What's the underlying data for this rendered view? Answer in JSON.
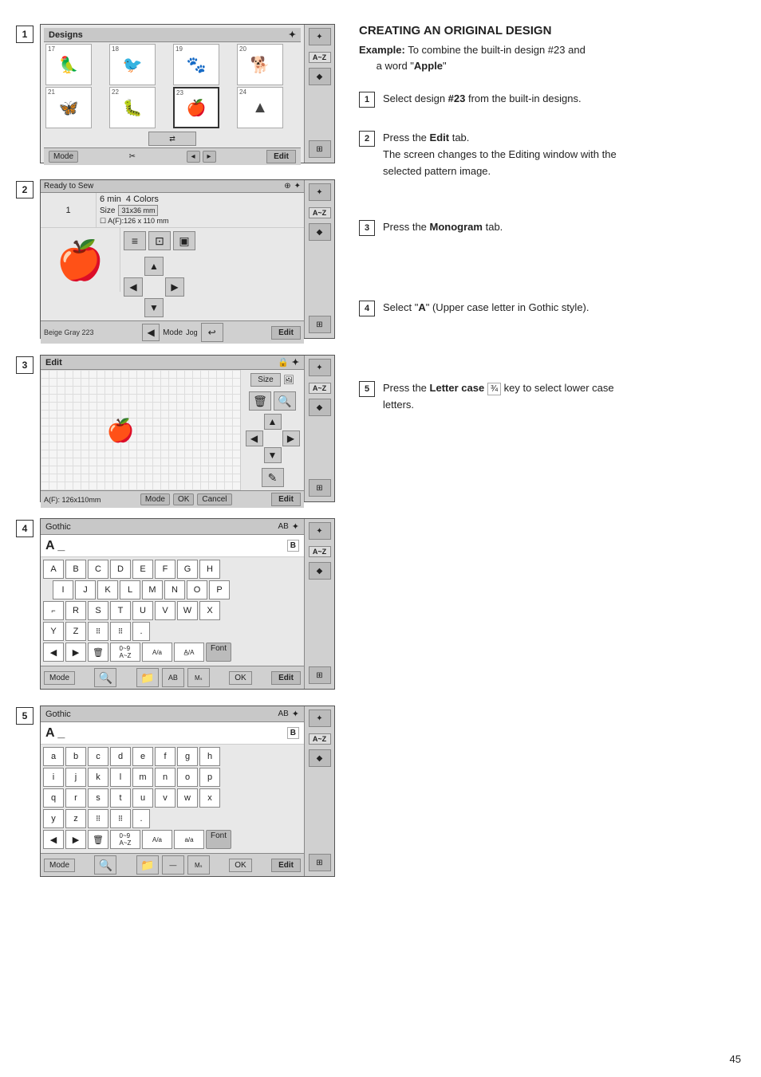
{
  "page": {
    "number": "45"
  },
  "right": {
    "title": "CREATING AN ORIGINAL DESIGN",
    "example_label": "Example:",
    "example_text": "To combine the built-in design #23 and a word \"Apple\"",
    "steps": [
      {
        "num": "1",
        "text": "Select design ",
        "bold": "#23",
        "text2": " from the built-in designs."
      },
      {
        "num": "2",
        "text": "Press the ",
        "bold": "Edit",
        "text2": " tab.\nThe screen changes to the Editing window with the selected pattern image."
      },
      {
        "num": "3",
        "text": "Press the ",
        "bold": "Monogram",
        "text2": " tab."
      },
      {
        "num": "4",
        "text": "Select \"",
        "bold": "A",
        "text2": "\" (Upper case letter in Gothic style)."
      },
      {
        "num": "5",
        "text": "Press the ",
        "bold": "Letter case",
        "text2": " key to select lower case letters."
      }
    ]
  },
  "screens": {
    "s1": {
      "title": "Designs",
      "nums": [
        "17",
        "18",
        "19",
        "20",
        "21",
        "22",
        "23",
        "24"
      ],
      "mode_label": "Mode",
      "edit_label": "Edit",
      "az_label": "A~Z"
    },
    "s2": {
      "title": "Ready to Sew",
      "time": "6 min",
      "colors": "4 Colors",
      "size_label": "Size",
      "size_val": "31x36 mm",
      "af_label": "A(F):126 x 110 mm",
      "thread_label": "Beige Gray 223",
      "mode_label": "Mode",
      "edit_label": "Edit",
      "az_label": "A~Z",
      "jog_label": "Jog"
    },
    "s3": {
      "title": "Edit",
      "size_label": "Size",
      "mode_label": "Mode",
      "ok_label": "OK",
      "cancel_label": "Cancel",
      "edit_label": "Edit",
      "af_label": "A(F): 126x110mm",
      "az_label": "A~Z"
    },
    "s4": {
      "font": "Gothic",
      "display": "A _",
      "uppercase_keys": [
        "A",
        "B",
        "C",
        "D",
        "E",
        "F",
        "G",
        "H",
        "I",
        "J",
        "K",
        "L",
        "M",
        "N",
        "O",
        "P",
        "Q",
        "R",
        "S",
        "T",
        "U",
        "V",
        "W",
        "X",
        "Y",
        "Z"
      ],
      "mode_label": "Mode",
      "ok_label": "OK",
      "edit_label": "Edit",
      "font_label": "Font",
      "az_label": "A~Z",
      "ab_label": "AB"
    },
    "s5": {
      "font": "Gothic",
      "display": "A _",
      "lowercase_keys": [
        "a",
        "b",
        "c",
        "d",
        "e",
        "f",
        "g",
        "h",
        "i",
        "j",
        "k",
        "l",
        "m",
        "n",
        "o",
        "p",
        "q",
        "r",
        "s",
        "t",
        "u",
        "v",
        "w",
        "x",
        "y",
        "z"
      ],
      "mode_label": "Mode",
      "ok_label": "OK",
      "edit_label": "Edit",
      "font_label": "Font",
      "az_label": "A~Z",
      "ab_label": "AB"
    }
  }
}
